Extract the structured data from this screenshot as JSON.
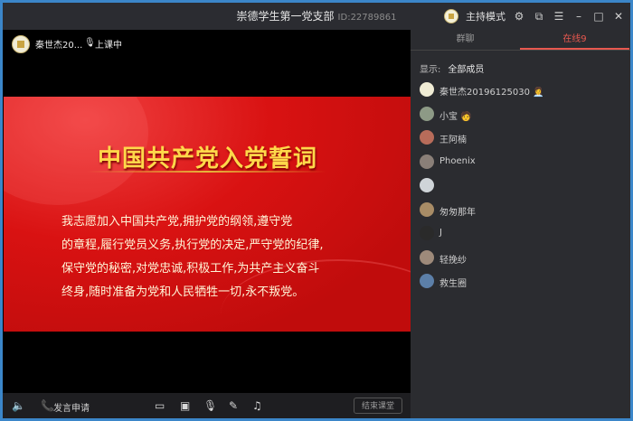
{
  "window": {
    "title": "崇德学生第一党支部",
    "id_text": "ID:22789861",
    "mode_label": "主持模式"
  },
  "stage": {
    "host_name": "秦世杰20...",
    "status": "上课中"
  },
  "slide": {
    "title": "中国共产党入党誓词",
    "lines": [
      "我志愿加入中国共产党,拥护党的纲领,遵守党",
      "的章程,履行党员义务,执行党的决定,严守党的纪律,",
      "保守党的秘密,对党忠诚,积极工作,为共产主义奋斗",
      "终身,随时准备为党和人民牺牲一切,永不叛党。"
    ]
  },
  "bottombar": {
    "speak_request": "发言申请",
    "end_class": "结束课堂"
  },
  "sidebar": {
    "tabs": [
      "群聊",
      "在线9"
    ],
    "filter_label": "显示:",
    "filter_value": "全部成员",
    "members": [
      {
        "name": "秦世杰20196125030",
        "badge": "host-badge",
        "avatar_color": "#f0ecd5"
      },
      {
        "name": "小宝",
        "badge": "person-badge",
        "avatar_color": "#8d9a86"
      },
      {
        "name": "王阿楠",
        "badge": "",
        "avatar_color": "#b86c5a"
      },
      {
        "name": "Phoenix",
        "badge": "",
        "avatar_color": "#8a7f78"
      },
      {
        "name": "",
        "badge": "",
        "avatar_color": "#cfd4d8"
      },
      {
        "name": "匆匆那年",
        "badge": "",
        "avatar_color": "#a88c66"
      },
      {
        "name": "J",
        "badge": "",
        "avatar_color": "#2a2a2a"
      },
      {
        "name": "轻挽纱",
        "badge": "",
        "avatar_color": "#9e8a7a"
      },
      {
        "name": "救生圈",
        "badge": "",
        "avatar_color": "#5c7fa8"
      }
    ]
  },
  "colors": {
    "accent": "#e8584f",
    "slide_red": "#d91212",
    "slide_gold": "#ffd84a"
  }
}
